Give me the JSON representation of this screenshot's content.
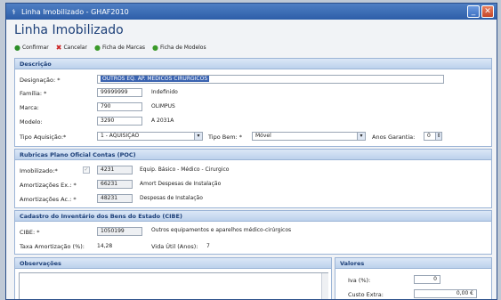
{
  "window": {
    "title": "Linha Imobilizado - GHAF2010",
    "icon": "app-icon"
  },
  "page_title": "Linha Imobilizado",
  "toolbar": [
    {
      "label": "Confirmar",
      "icon": "check-icon"
    },
    {
      "label": "Cancelar",
      "icon": "x-icon"
    },
    {
      "label": "Ficha de Marcas",
      "icon": "green-circle-icon"
    },
    {
      "label": "Ficha de Modelos",
      "icon": "green-circle-icon"
    }
  ],
  "descricao": {
    "header": "Descrição",
    "designacao_label": "Designação: *",
    "designacao_value": "OUTROS EQ. AP. MEDICOS CIRURGICOS",
    "familia_label": "Família: *",
    "familia_value": "99999999",
    "familia_desc": "Indefinido",
    "marca_label": "Marca:",
    "marca_value": "790",
    "marca_desc": "OLIMPUS",
    "modelo_label": "Modelo:",
    "modelo_value": "3290",
    "modelo_desc": "A 2031A",
    "tipo_aquisicao_label": "Tipo Aquisição:*",
    "tipo_aquisicao_value": "1 - AQUISIÇÃO",
    "tipo_bem_label": "Tipo Bem: *",
    "tipo_bem_value": "Móvel",
    "anos_garantia_label": "Anos Garantia:",
    "anos_garantia_value": "0"
  },
  "poc": {
    "header": "Rubricas Plano Oficial Contas (POC)",
    "imobilizado_label": "Imobilizado:*",
    "imobilizado_value": "4231",
    "imobilizado_desc": "Equip. Básico - Médico - Cirurgico",
    "amort_ex_label": "Amortizações Ex.: *",
    "amort_ex_value": "66231",
    "amort_ex_desc": "Amort Despesas de Instalação",
    "amort_ac_label": "Amortizações Ac.: *",
    "amort_ac_value": "48231",
    "amort_ac_desc": "Despesas de Instalação"
  },
  "cibe": {
    "header": "Cadastro do Inventário dos Bens do Estado (CIBE)",
    "cibe_label": "CIBE: *",
    "cibe_value": "1050199",
    "cibe_desc": "Outros equipamentos e aparelhos médico-cirúrgicos",
    "taxa_label": "Taxa Amortização (%):",
    "taxa_value": "14,28",
    "vida_label": "Vida Útil (Anos):",
    "vida_value": "7"
  },
  "observacoes": {
    "header": "Observações"
  },
  "valores": {
    "header": "Valores",
    "iva_label": "Iva (%):",
    "iva_value": "0",
    "custo_label": "Custo Extra:",
    "custo_value": "0,00 €"
  }
}
